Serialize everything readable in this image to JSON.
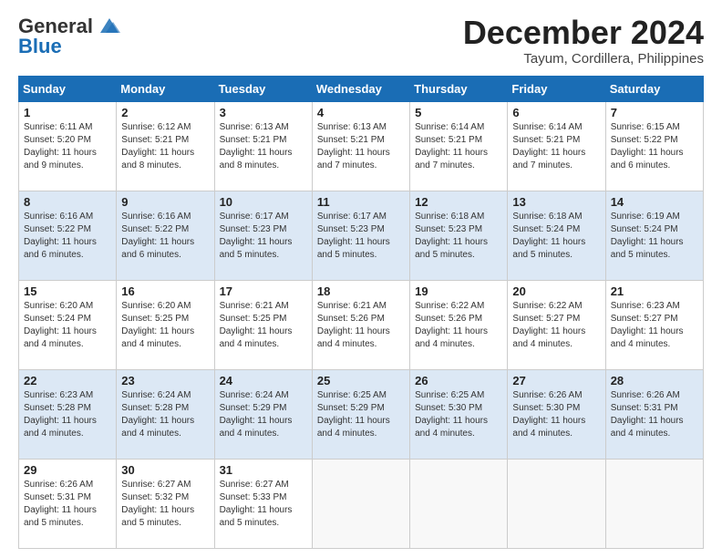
{
  "logo": {
    "line1": "General",
    "line2": "Blue"
  },
  "header": {
    "month_year": "December 2024",
    "location": "Tayum, Cordillera, Philippines"
  },
  "days_of_week": [
    "Sunday",
    "Monday",
    "Tuesday",
    "Wednesday",
    "Thursday",
    "Friday",
    "Saturday"
  ],
  "weeks": [
    [
      {
        "day": "1",
        "sunrise": "6:11 AM",
        "sunset": "5:20 PM",
        "daylight": "11 hours and 9 minutes."
      },
      {
        "day": "2",
        "sunrise": "6:12 AM",
        "sunset": "5:21 PM",
        "daylight": "11 hours and 8 minutes."
      },
      {
        "day": "3",
        "sunrise": "6:13 AM",
        "sunset": "5:21 PM",
        "daylight": "11 hours and 8 minutes."
      },
      {
        "day": "4",
        "sunrise": "6:13 AM",
        "sunset": "5:21 PM",
        "daylight": "11 hours and 7 minutes."
      },
      {
        "day": "5",
        "sunrise": "6:14 AM",
        "sunset": "5:21 PM",
        "daylight": "11 hours and 7 minutes."
      },
      {
        "day": "6",
        "sunrise": "6:14 AM",
        "sunset": "5:21 PM",
        "daylight": "11 hours and 7 minutes."
      },
      {
        "day": "7",
        "sunrise": "6:15 AM",
        "sunset": "5:22 PM",
        "daylight": "11 hours and 6 minutes."
      }
    ],
    [
      {
        "day": "8",
        "sunrise": "6:16 AM",
        "sunset": "5:22 PM",
        "daylight": "11 hours and 6 minutes."
      },
      {
        "day": "9",
        "sunrise": "6:16 AM",
        "sunset": "5:22 PM",
        "daylight": "11 hours and 6 minutes."
      },
      {
        "day": "10",
        "sunrise": "6:17 AM",
        "sunset": "5:23 PM",
        "daylight": "11 hours and 5 minutes."
      },
      {
        "day": "11",
        "sunrise": "6:17 AM",
        "sunset": "5:23 PM",
        "daylight": "11 hours and 5 minutes."
      },
      {
        "day": "12",
        "sunrise": "6:18 AM",
        "sunset": "5:23 PM",
        "daylight": "11 hours and 5 minutes."
      },
      {
        "day": "13",
        "sunrise": "6:18 AM",
        "sunset": "5:24 PM",
        "daylight": "11 hours and 5 minutes."
      },
      {
        "day": "14",
        "sunrise": "6:19 AM",
        "sunset": "5:24 PM",
        "daylight": "11 hours and 5 minutes."
      }
    ],
    [
      {
        "day": "15",
        "sunrise": "6:20 AM",
        "sunset": "5:24 PM",
        "daylight": "11 hours and 4 minutes."
      },
      {
        "day": "16",
        "sunrise": "6:20 AM",
        "sunset": "5:25 PM",
        "daylight": "11 hours and 4 minutes."
      },
      {
        "day": "17",
        "sunrise": "6:21 AM",
        "sunset": "5:25 PM",
        "daylight": "11 hours and 4 minutes."
      },
      {
        "day": "18",
        "sunrise": "6:21 AM",
        "sunset": "5:26 PM",
        "daylight": "11 hours and 4 minutes."
      },
      {
        "day": "19",
        "sunrise": "6:22 AM",
        "sunset": "5:26 PM",
        "daylight": "11 hours and 4 minutes."
      },
      {
        "day": "20",
        "sunrise": "6:22 AM",
        "sunset": "5:27 PM",
        "daylight": "11 hours and 4 minutes."
      },
      {
        "day": "21",
        "sunrise": "6:23 AM",
        "sunset": "5:27 PM",
        "daylight": "11 hours and 4 minutes."
      }
    ],
    [
      {
        "day": "22",
        "sunrise": "6:23 AM",
        "sunset": "5:28 PM",
        "daylight": "11 hours and 4 minutes."
      },
      {
        "day": "23",
        "sunrise": "6:24 AM",
        "sunset": "5:28 PM",
        "daylight": "11 hours and 4 minutes."
      },
      {
        "day": "24",
        "sunrise": "6:24 AM",
        "sunset": "5:29 PM",
        "daylight": "11 hours and 4 minutes."
      },
      {
        "day": "25",
        "sunrise": "6:25 AM",
        "sunset": "5:29 PM",
        "daylight": "11 hours and 4 minutes."
      },
      {
        "day": "26",
        "sunrise": "6:25 AM",
        "sunset": "5:30 PM",
        "daylight": "11 hours and 4 minutes."
      },
      {
        "day": "27",
        "sunrise": "6:26 AM",
        "sunset": "5:30 PM",
        "daylight": "11 hours and 4 minutes."
      },
      {
        "day": "28",
        "sunrise": "6:26 AM",
        "sunset": "5:31 PM",
        "daylight": "11 hours and 4 minutes."
      }
    ],
    [
      {
        "day": "29",
        "sunrise": "6:26 AM",
        "sunset": "5:31 PM",
        "daylight": "11 hours and 5 minutes."
      },
      {
        "day": "30",
        "sunrise": "6:27 AM",
        "sunset": "5:32 PM",
        "daylight": "11 hours and 5 minutes."
      },
      {
        "day": "31",
        "sunrise": "6:27 AM",
        "sunset": "5:33 PM",
        "daylight": "11 hours and 5 minutes."
      },
      null,
      null,
      null,
      null
    ]
  ],
  "labels": {
    "sunrise": "Sunrise:",
    "sunset": "Sunset:",
    "daylight": "Daylight:"
  }
}
